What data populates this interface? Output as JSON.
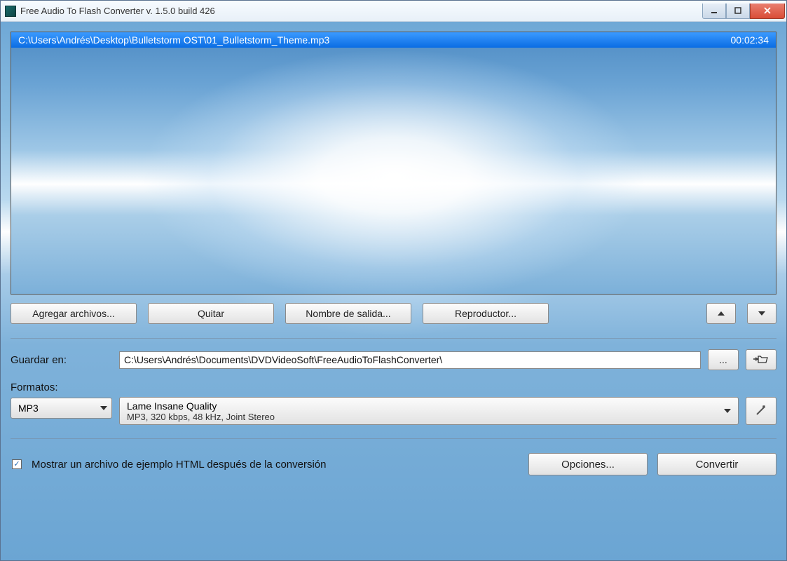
{
  "window": {
    "title": "Free Audio To Flash Converter  v. 1.5.0 build 426"
  },
  "files": [
    {
      "path": "C:\\Users\\Andrés\\Desktop\\Bulletstorm OST\\01_Bulletstorm_Theme.mp3",
      "duration": "00:02:34"
    }
  ],
  "toolbar": {
    "add_files": "Agregar archivos...",
    "remove": "Quitar",
    "output_name": "Nombre de salida...",
    "player": "Reproductor..."
  },
  "save": {
    "label": "Guardar en:",
    "path": "C:\\Users\\Andrés\\Documents\\DVDVideoSoft\\FreeAudioToFlashConverter\\",
    "browse": "..."
  },
  "formats": {
    "label": "Formatos:",
    "codec": "MP3",
    "quality_name": "Lame Insane Quality",
    "quality_detail": "MP3, 320 kbps, 48 kHz, Joint Stereo"
  },
  "footer": {
    "show_example": "Mostrar un archivo de ejemplo HTML después de la conversión",
    "options": "Opciones...",
    "convert": "Convertir"
  }
}
